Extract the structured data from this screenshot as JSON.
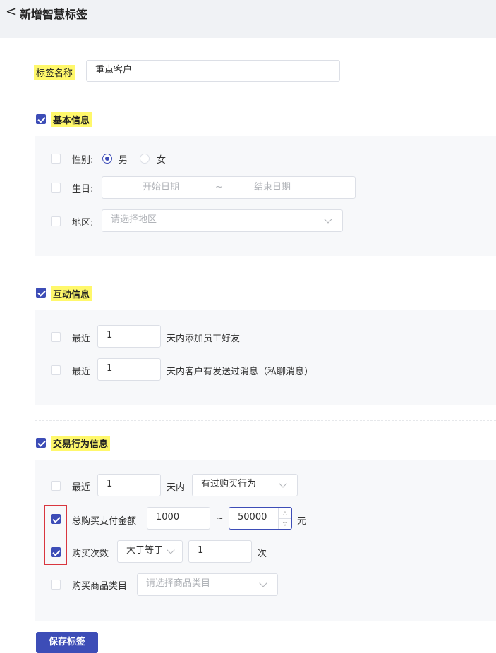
{
  "header": {
    "title": "新增智慧标签"
  },
  "tag_name": {
    "label": "标签名称",
    "value": "重点客户"
  },
  "basic": {
    "title": "基本信息",
    "gender": {
      "label": "性别:",
      "male": "男",
      "female": "女",
      "selected": "男"
    },
    "birthday": {
      "label": "生日:",
      "start": "开始日期",
      "sep": "~",
      "end": "结束日期"
    },
    "region": {
      "label": "地区:",
      "placeholder": "请选择地区"
    }
  },
  "interaction": {
    "title": "互动信息",
    "row1": {
      "prefix": "最近",
      "value": "1",
      "suffix": "天内添加员工好友"
    },
    "row2": {
      "prefix": "最近",
      "value": "1",
      "suffix": "天内客户有发送过消息（私聊消息）"
    }
  },
  "transaction": {
    "title": "交易行为信息",
    "recent": {
      "prefix": "最近",
      "value": "1",
      "mid": "天内",
      "select": "有过购买行为"
    },
    "amount": {
      "label": "总购买支付金额",
      "min": "1000",
      "sep": "~",
      "max": "50000",
      "unit": "元"
    },
    "count": {
      "label": "购买次数",
      "operator": "大于等于",
      "value": "1",
      "unit": "次"
    },
    "category": {
      "label": "购买商品类目",
      "placeholder": "请选择商品类目"
    }
  },
  "save_button": "保存标签",
  "accent_color": "#3d4db7",
  "highlight_color": "#fff86b"
}
